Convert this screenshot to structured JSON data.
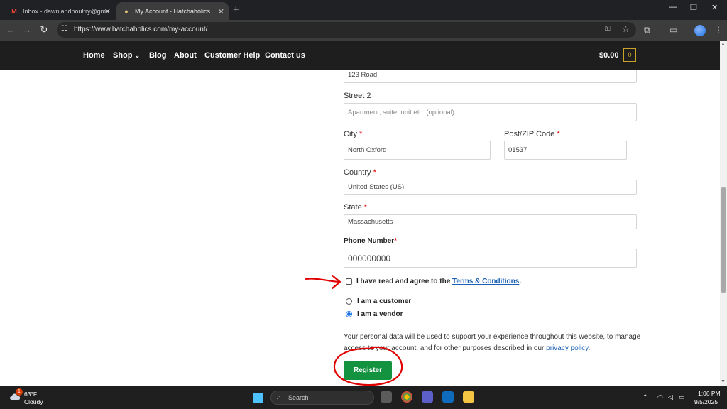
{
  "browser": {
    "tabs": [
      {
        "title": "Inbox - dawnlandpoultry@gma",
        "favicon": "gmail-icon"
      },
      {
        "title": "My Account - Hatchaholics",
        "favicon": "site-icon"
      }
    ],
    "url": "https://www.hatchaholics.com/my-account/"
  },
  "site": {
    "nav": [
      "Home",
      "Shop",
      "Blog",
      "About",
      "Customer Help",
      "Contact us"
    ],
    "shop_caret": "⌄",
    "cart_total": "$0.00",
    "cart_count": "0"
  },
  "form": {
    "street1_value": "123 Road",
    "street2_label": "Street 2",
    "street2_placeholder": "Apartment, suite, unit etc. (optional)",
    "city_label": "City",
    "city_value": "North Oxford",
    "zip_label": "Post/ZIP Code",
    "zip_value": "01537",
    "country_label": "Country",
    "country_value": "United States (US)",
    "state_label": "State",
    "state_value": "Massachusetts",
    "phone_label": "Phone Number",
    "phone_value": "000000000",
    "required_mark": "*",
    "terms_prefix": "I have read and agree to the",
    "terms_link": "Terms & Conditions",
    "terms_suffix": ".",
    "role_customer": "I am a customer",
    "role_vendor": "I am a vendor",
    "privacy_text": "Your personal data will be used to support your experience throughout this website, to manage access to your account, and for other purposes described in our",
    "privacy_link": "privacy policy",
    "privacy_suffix": ".",
    "register_label": "Register"
  },
  "taskbar": {
    "weather_temp": "63°F",
    "weather_condition": "Cloudy",
    "weather_badge": "1",
    "search_placeholder": "Search",
    "time": "1:06 PM",
    "date": "9/5/2025"
  },
  "colors": {
    "register_green": "#13923f",
    "annotation_red": "#e00000",
    "link_blue": "#1a5fb4"
  }
}
